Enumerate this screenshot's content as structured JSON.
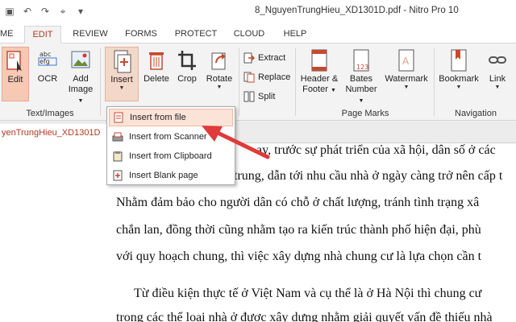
{
  "window": {
    "title": "8_NguyenTrungHieu_XD1301D.pdf - Nitro Pro 10"
  },
  "quick_access": {
    "save_glyph": "▣",
    "undo_glyph": "↶",
    "redo_glyph": "↷",
    "cursor_glyph": "⌖",
    "more_glyph": "▾"
  },
  "tabs": [
    {
      "label": "ME"
    },
    {
      "label": "EDIT"
    },
    {
      "label": "REVIEW"
    },
    {
      "label": "FORMS"
    },
    {
      "label": "PROTECT"
    },
    {
      "label": "CLOUD"
    },
    {
      "label": "HELP"
    }
  ],
  "ribbon": {
    "edit": "Edit",
    "ocr": "OCR",
    "add_image_1": "Add",
    "add_image_2": "Image",
    "insert": "Insert",
    "delete": "Delete",
    "crop": "Crop",
    "rotate": "Rotate",
    "extract": "Extract",
    "replace": "Replace",
    "split": "Split",
    "header_1": "Header &",
    "header_2": "Footer",
    "bates_1": "Bates",
    "bates_2": "Number",
    "watermark": "Watermark",
    "bookmark": "Bookmark",
    "link": "Link",
    "groups": {
      "text_images": "Text/Images",
      "page_marks": "Page Marks",
      "navigation": "Navigation"
    }
  },
  "insert_menu": {
    "items": [
      {
        "label": "Insert from file"
      },
      {
        "label": "Insert from Scanner"
      },
      {
        "label": "Insert from Clipboard"
      },
      {
        "label": "Insert Blank page"
      }
    ]
  },
  "document": {
    "tab_label": "yenTrungHieu_XD1301D",
    "lines": [
      "ay,  trước sự phát triển của xã hội, dân số ở các",
      "trung, dẫn tới nhu cầu nhà ở ngày càng trở nên cấp t",
      "Nhằm đảm bảo cho người dân có chỗ ở chất lượng, tránh tình trạng xâ",
      "chắn lan, đồng thời cũng nhằm tạo ra kiến trúc thành phố hiện đại, phù",
      "với quy hoạch chung, thì việc xây dựng nhà chung cư là lựa chọn cần t",
      "Từ điều kiện thực tế ở Việt Nam và cụ thể là ở Hà Nội thì chung cư",
      "trong các thể loại nhà ở được xây dựng nhằm giải quyết vấn đề thiếu nhà"
    ]
  },
  "colors": {
    "accent": "#b03a24",
    "highlight": "#f6c9b4",
    "arrow": "#e03a3a"
  }
}
